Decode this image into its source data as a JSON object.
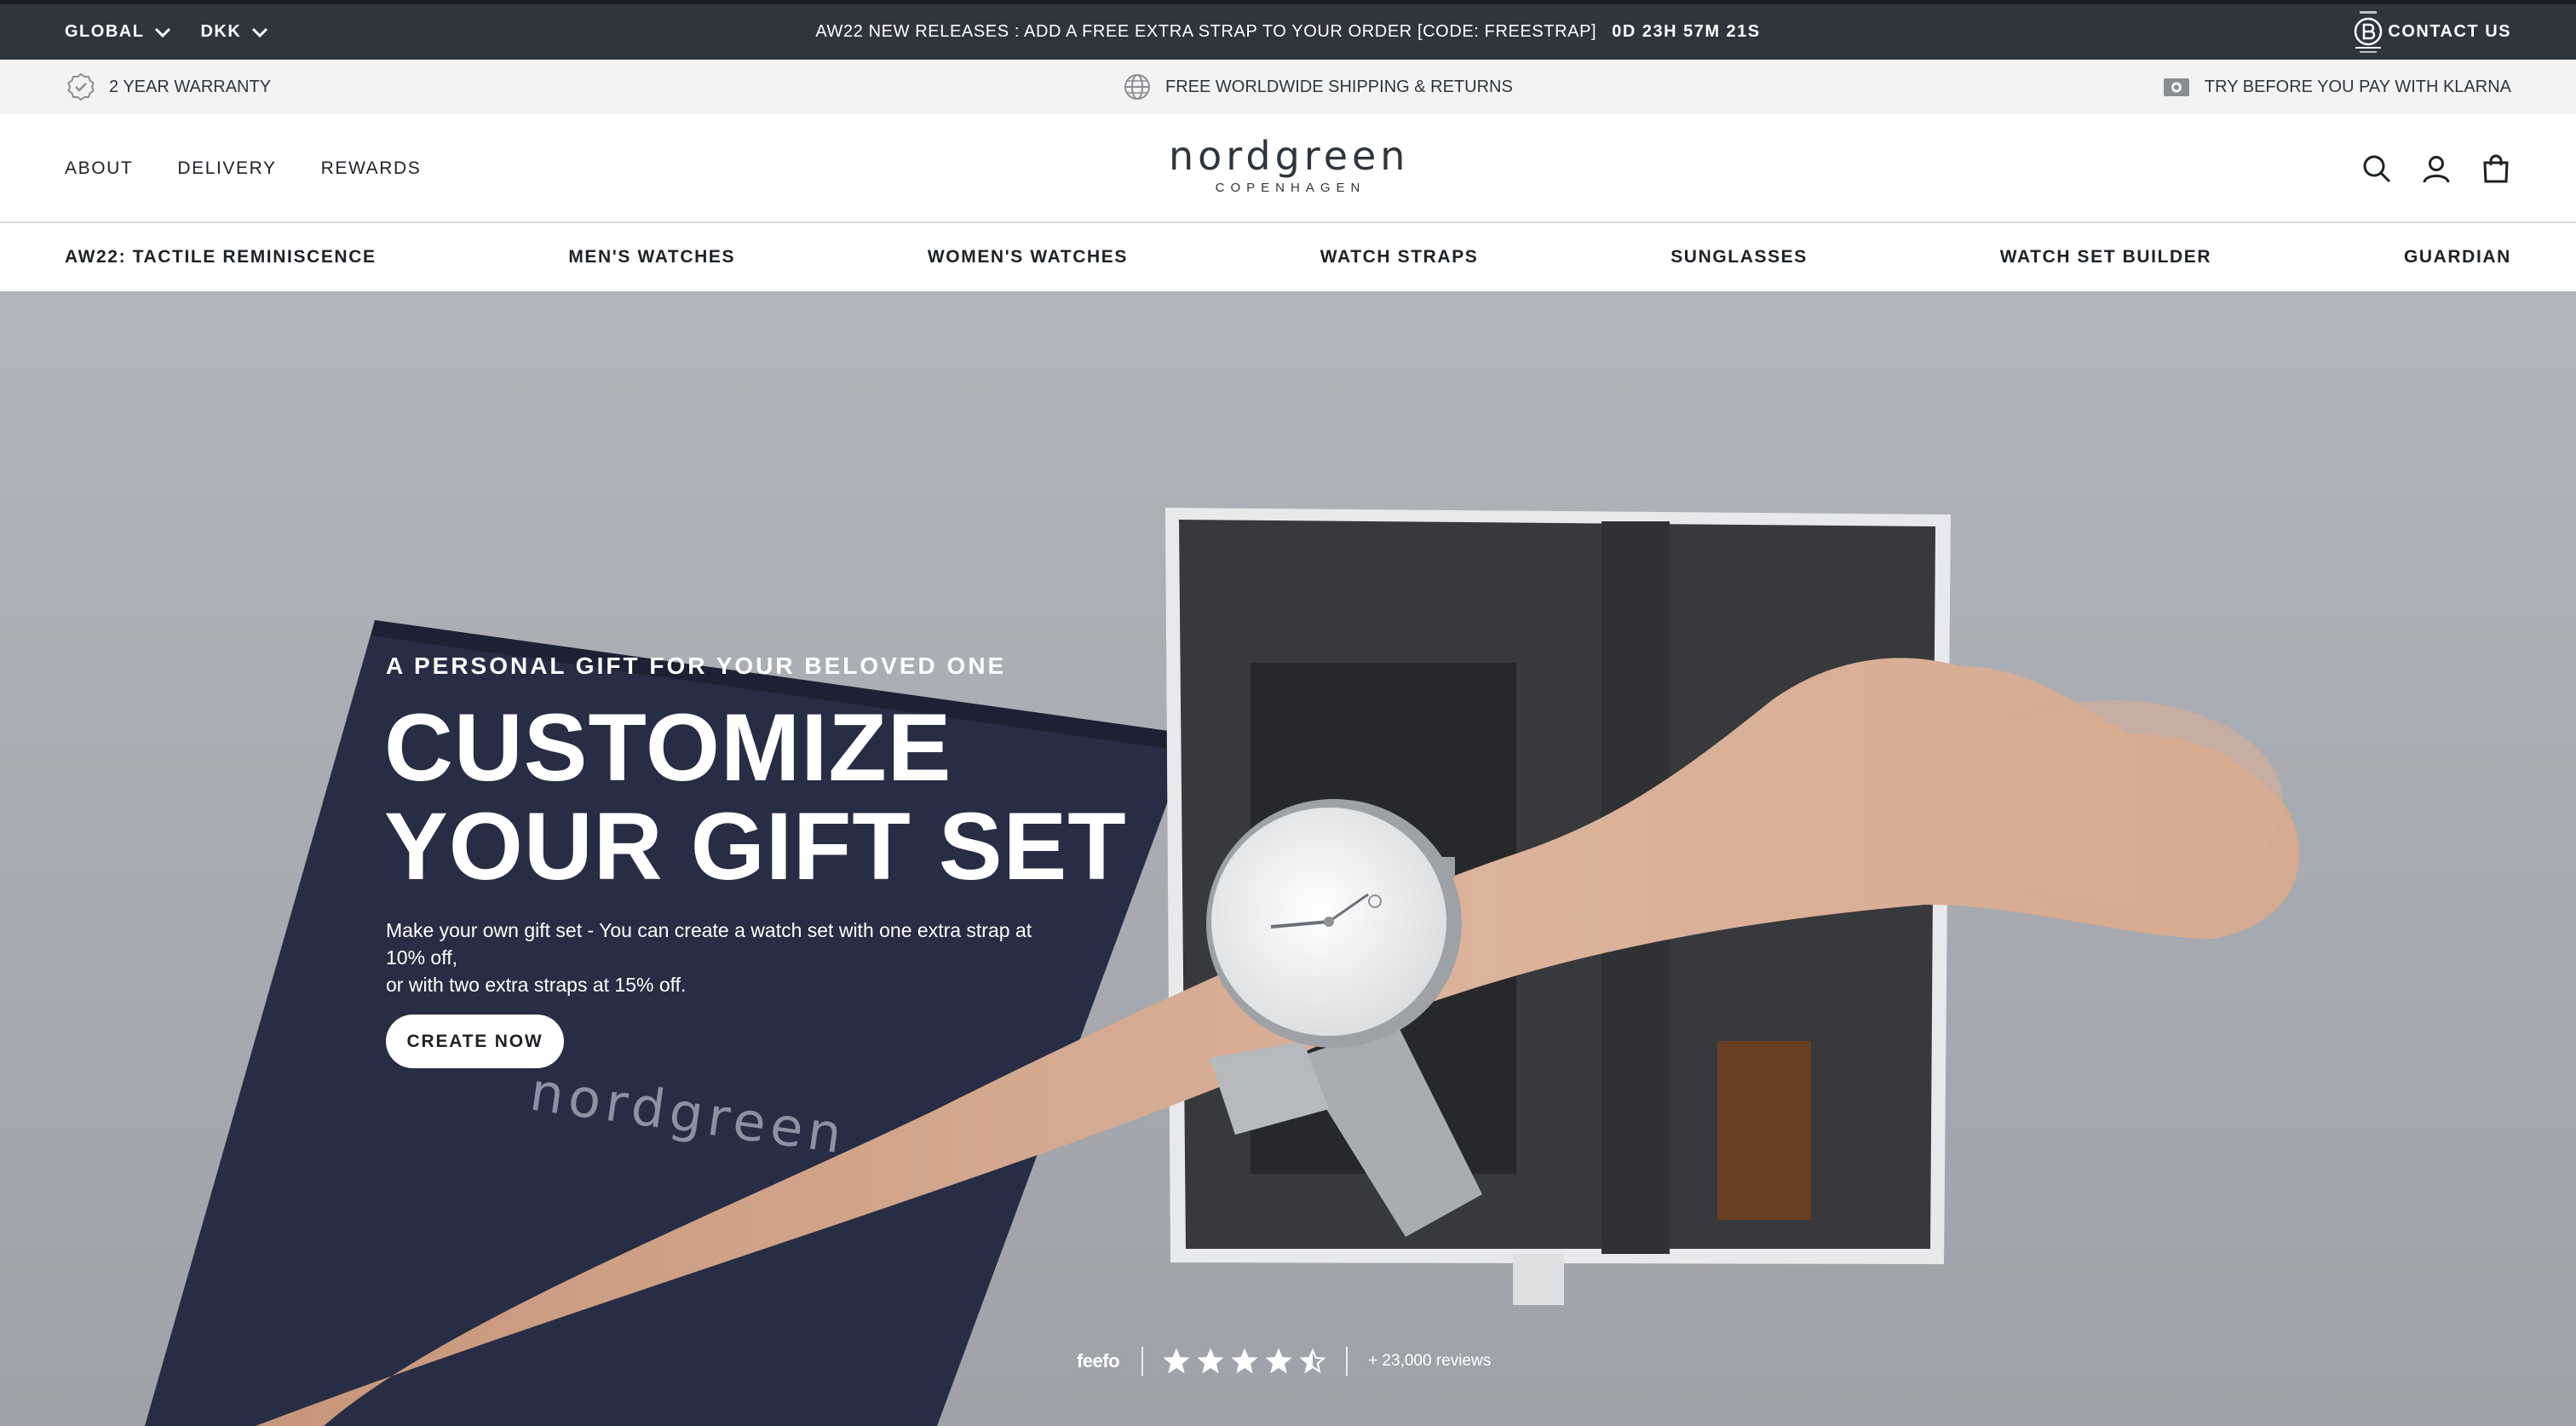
{
  "topbar": {
    "region": "GLOBAL",
    "currency": "DKK",
    "promo": "AW22 NEW RELEASES : ADD A FREE EXTRA STRAP TO YOUR ORDER [CODE: FREESTRAP]",
    "countdown": "0D 23H 57M 21S",
    "contact": "CONTACT US"
  },
  "usp": {
    "warranty": "2 YEAR WARRANTY",
    "shipping": "FREE WORLDWIDE SHIPPING & RETURNS",
    "klarna": "TRY BEFORE YOU PAY WITH KLARNA"
  },
  "header": {
    "nav": [
      "ABOUT",
      "DELIVERY",
      "REWARDS"
    ],
    "logo_word": "nordgreen",
    "logo_sub": "COPENHAGEN",
    "icons": [
      "search-icon",
      "account-icon",
      "bag-icon"
    ]
  },
  "categories": [
    "AW22: TACTILE REMINISCENCE",
    "MEN'S WATCHES",
    "WOMEN'S WATCHES",
    "WATCH STRAPS",
    "SUNGLASSES",
    "WATCH SET BUILDER",
    "GUARDIAN"
  ],
  "hero": {
    "kicker": "A PERSONAL GIFT FOR YOUR BELOVED ONE",
    "headline_1": "CUSTOMIZE",
    "headline_2": "YOUR GIFT SET",
    "body_1": "Make your own gift set - You can create a watch set with one extra strap at 10% off,",
    "body_2": "or with two extra straps at 15% off.",
    "cta": "CREATE NOW",
    "box_logo": "nordgreen"
  },
  "reviews": {
    "provider": "feefo",
    "rating": 4.5,
    "rating_max": 5,
    "count": "+ 23,000 reviews"
  },
  "colors": {
    "topbar_bg": "#2e353d",
    "usp_bg": "#f3f3f3",
    "hero_bg": "#a8abb1",
    "text_dark": "#1d2128"
  }
}
